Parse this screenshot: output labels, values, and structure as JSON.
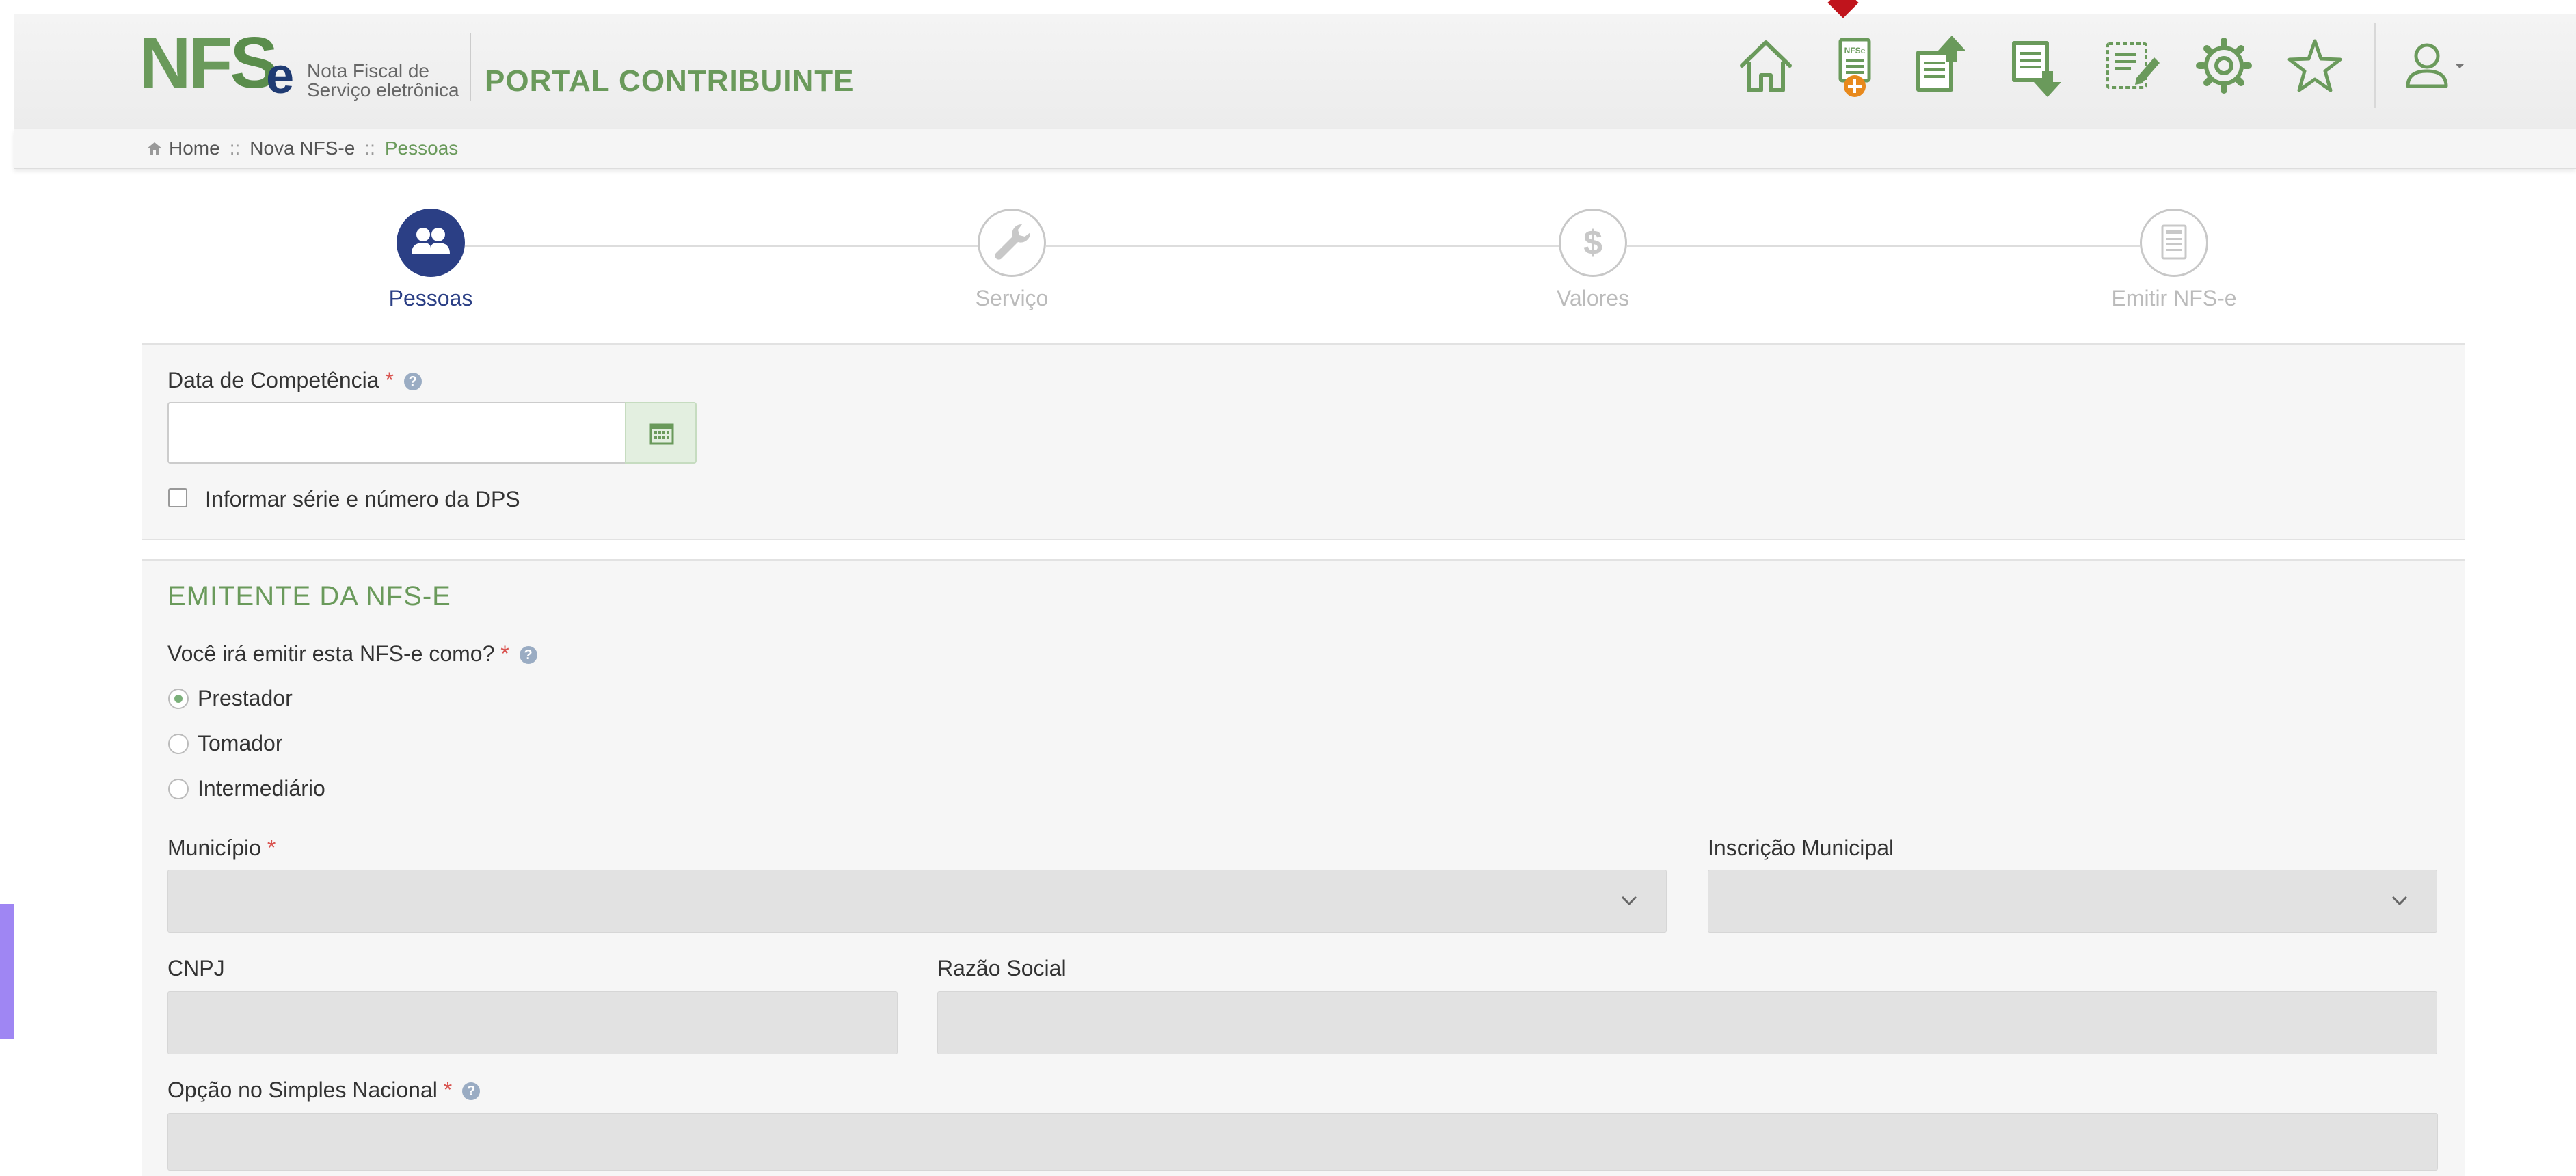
{
  "logo": {
    "nfs_n": "N",
    "nfs_f": "F",
    "nfs_s": "S",
    "nfs_e": "e",
    "subtitle_line1": "Nota Fiscal de",
    "subtitle_line2": "Serviço eletrônica"
  },
  "header": {
    "portal_title": "PORTAL CONTRIBUINTE",
    "nav_icons": [
      "home-icon",
      "new-nfse-icon",
      "export-document-icon",
      "import-document-icon",
      "edit-document-icon",
      "gear-icon",
      "star-icon",
      "user-icon"
    ]
  },
  "breadcrumb": {
    "home": "Home",
    "separator": "::",
    "nova": "Nova NFS-e",
    "current": "Pessoas"
  },
  "steps": [
    {
      "label": "Pessoas",
      "active": true,
      "icon": "people-icon"
    },
    {
      "label": "Serviço",
      "active": false,
      "icon": "wrench-icon"
    },
    {
      "label": "Valores",
      "active": false,
      "icon": "dollar-icon"
    },
    {
      "label": "Emitir NFS-e",
      "active": false,
      "icon": "nfse-document-icon"
    }
  ],
  "competencia": {
    "label": "Data de Competência",
    "required_mark": "*",
    "help": "?",
    "value": "",
    "checkbox_label": "Informar série e número da DPS",
    "checkbox_checked": false
  },
  "emitente": {
    "title": "EMITENTE DA NFS-E",
    "question": "Você irá emitir esta NFS-e como?",
    "required_mark": "*",
    "help": "?",
    "options": [
      {
        "label": "Prestador",
        "checked": true
      },
      {
        "label": "Tomador",
        "checked": false
      },
      {
        "label": "Intermediário",
        "checked": false
      }
    ],
    "municipio_label": "Município",
    "inscricao_label": "Inscrição Municipal",
    "cnpj_label": "CNPJ",
    "razao_label": "Razão Social",
    "simples_label": "Opção no Simples Nacional"
  },
  "colors": {
    "brand_green": "#6a9a5b",
    "step_active": "#2b3f85",
    "step_inactive": "#c8c8c8",
    "required": "#d9534f",
    "marker": "#c0141c"
  }
}
